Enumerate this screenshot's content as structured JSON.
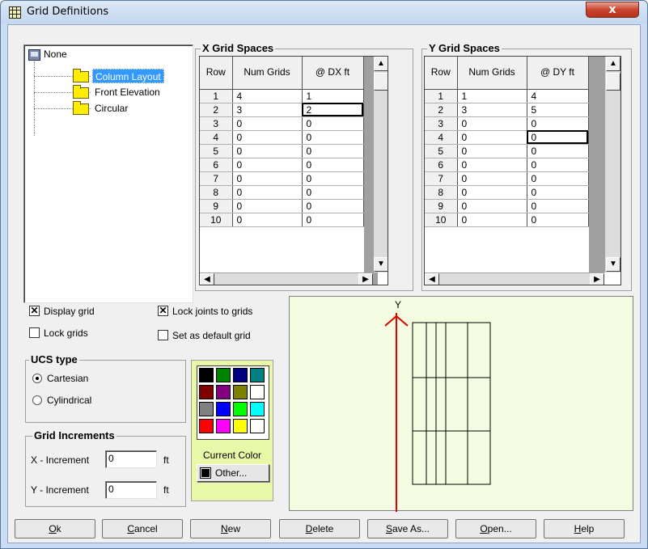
{
  "window": {
    "title": "Grid Definitions",
    "close_label": "x"
  },
  "tree": {
    "root": "None",
    "items": [
      {
        "label": "Column Layout",
        "selected": true
      },
      {
        "label": "Front Elevation",
        "selected": false
      },
      {
        "label": "Circular",
        "selected": false
      }
    ]
  },
  "x_grid": {
    "title": "X Grid Spaces",
    "headers": {
      "row": "Row",
      "num_grids": "Num Grids",
      "spacing": "@ DX ft"
    },
    "rows": [
      [
        "1",
        "4",
        "1"
      ],
      [
        "2",
        "3",
        "2"
      ],
      [
        "3",
        "0",
        "0"
      ],
      [
        "4",
        "0",
        "0"
      ],
      [
        "5",
        "0",
        "0"
      ],
      [
        "6",
        "0",
        "0"
      ],
      [
        "7",
        "0",
        "0"
      ],
      [
        "8",
        "0",
        "0"
      ],
      [
        "9",
        "0",
        "0"
      ],
      [
        "10",
        "0",
        "0"
      ]
    ]
  },
  "y_grid": {
    "title": "Y Grid Spaces",
    "headers": {
      "row": "Row",
      "num_grids": "Num Grids",
      "spacing": "@ DY ft"
    },
    "rows": [
      [
        "1",
        "1",
        "4"
      ],
      [
        "2",
        "3",
        "5"
      ],
      [
        "3",
        "0",
        "0"
      ],
      [
        "4",
        "0",
        "0"
      ],
      [
        "5",
        "0",
        "0"
      ],
      [
        "6",
        "0",
        "0"
      ],
      [
        "7",
        "0",
        "0"
      ],
      [
        "8",
        "0",
        "0"
      ],
      [
        "9",
        "0",
        "0"
      ],
      [
        "10",
        "0",
        "0"
      ]
    ]
  },
  "options": {
    "display_grid": {
      "label": "Display grid",
      "checked": true
    },
    "lock_grids": {
      "label": "Lock grids",
      "checked": false
    },
    "lock_joints": {
      "label": "Lock joints to grids",
      "checked": true
    },
    "set_default": {
      "label": "Set as default grid",
      "checked": false
    }
  },
  "ucs": {
    "title": "UCS type",
    "cartesian": "Cartesian",
    "cylindrical": "Cylindrical",
    "selected": "Cartesian"
  },
  "increments": {
    "title": "Grid Increments",
    "x_label": "X - Increment",
    "x_value": "0",
    "x_unit": "ft",
    "y_label": "Y - Increment",
    "y_value": "0",
    "y_unit": "ft"
  },
  "palette": {
    "colors": [
      "#000000",
      "#008000",
      "#000080",
      "#008080",
      "#800000",
      "#800080",
      "#808000",
      "#ffffff",
      "#808080",
      "#0000ff",
      "#00ff00",
      "#00ffff",
      "#ff0000",
      "#ff00ff",
      "#ffff00",
      "#ffffff"
    ],
    "current_label": "Current Color",
    "other_label": "Other...",
    "current_color": "#000000"
  },
  "preview": {
    "axis_label": "Y",
    "axis_color": "#e00000"
  },
  "buttons": {
    "ok": {
      "u": "O",
      "rest": "k"
    },
    "cancel": {
      "u": "C",
      "rest": "ancel"
    },
    "new": {
      "u": "N",
      "rest": "ew"
    },
    "delete": {
      "u": "D",
      "rest": "elete"
    },
    "save_as": {
      "u": "S",
      "rest": "ave As..."
    },
    "open": {
      "u": "O",
      "rest": "pen...",
      "pre": ""
    },
    "help": {
      "u": "H",
      "rest": "elp"
    }
  }
}
